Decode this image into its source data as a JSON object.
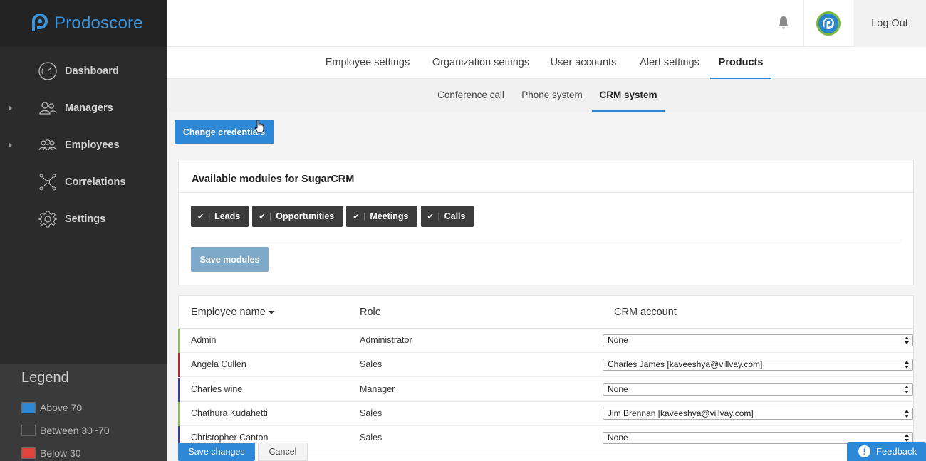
{
  "brand": {
    "name": "Prodoscore",
    "color": "#3a96e0"
  },
  "sidebar": {
    "items": [
      {
        "label": "Dashboard",
        "icon": "gauge-icon",
        "has_caret": false
      },
      {
        "label": "Managers",
        "icon": "managers-icon",
        "has_caret": true
      },
      {
        "label": "Employees",
        "icon": "employees-icon",
        "has_caret": true
      },
      {
        "label": "Correlations",
        "icon": "network-icon",
        "has_caret": false
      },
      {
        "label": "Settings",
        "icon": "gear-icon",
        "has_caret": false
      }
    ]
  },
  "legend": {
    "title": "Legend",
    "items": [
      {
        "label": "Above 70",
        "color": "#2d89d8"
      },
      {
        "label": "Between 30~70",
        "color": "#3a3a3a"
      },
      {
        "label": "Below 30",
        "color": "#e0443c"
      }
    ]
  },
  "header": {
    "logout_label": "Log Out"
  },
  "tabs_primary": {
    "items": [
      "Employee settings",
      "Organization settings",
      "User accounts",
      "Alert settings",
      "Products"
    ],
    "active": "Products"
  },
  "tabs_secondary": {
    "items": [
      "Conference call",
      "Phone system",
      "CRM system"
    ],
    "active": "CRM system"
  },
  "actions": {
    "change_credentials": "Change credentials"
  },
  "modules": {
    "title": "Available modules for SugarCRM",
    "chips": [
      "Leads",
      "Opportunities",
      "Meetings",
      "Calls"
    ],
    "save_label": "Save modules"
  },
  "table": {
    "columns": {
      "name": "Employee name",
      "role": "Role",
      "crm": "CRM account"
    },
    "rows": [
      {
        "name": "Admin",
        "role": "Administrator",
        "crm": "None",
        "bar_color": "#8bc34a"
      },
      {
        "name": "Angela Cullen",
        "role": "Sales",
        "crm": "Charles James [kaveeshya@villvay.com]",
        "bar_color": "#b22a3a"
      },
      {
        "name": "Charles wine",
        "role": "Manager",
        "crm": "None",
        "bar_color": "#3a3aa8"
      },
      {
        "name": "Chathura Kudahetti",
        "role": "Sales",
        "crm": "Jim Brennan [kaveeshya@villvay.com]",
        "bar_color": "#8bc34a"
      },
      {
        "name": "Christopher Canton",
        "role": "Sales",
        "crm": "None",
        "bar_color": "#3a3aa8"
      }
    ]
  },
  "footer": {
    "save_label": "Save changes",
    "cancel_label": "Cancel"
  },
  "feedback": {
    "label": "Feedback"
  }
}
